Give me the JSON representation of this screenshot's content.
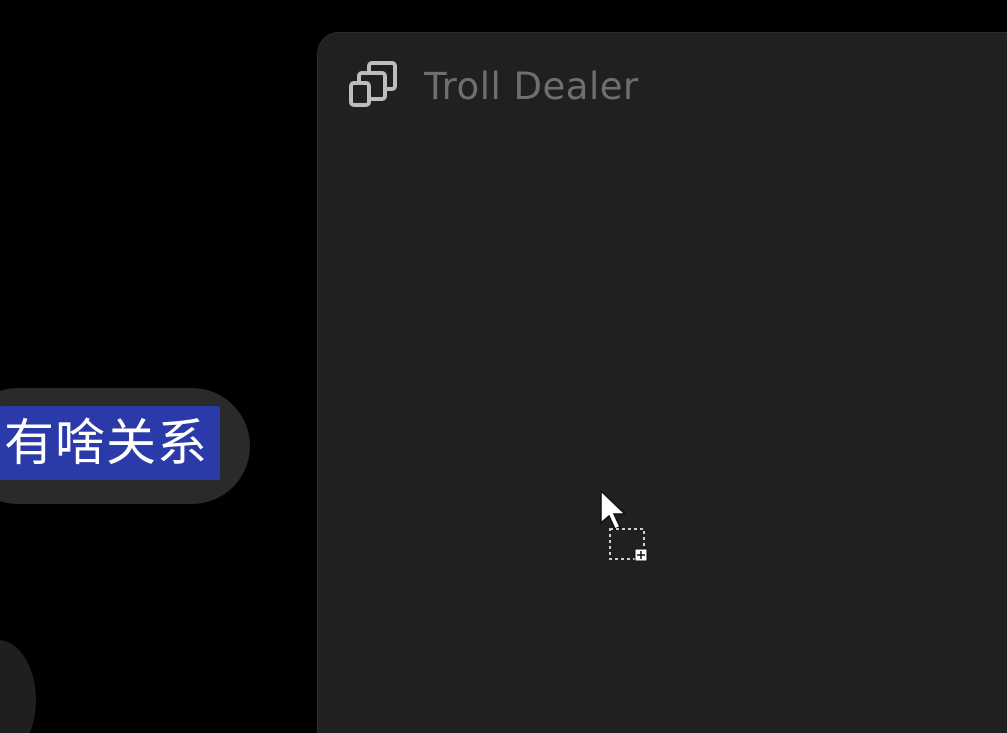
{
  "chat": {
    "highlighted_text": "有啥关系"
  },
  "window": {
    "title": "Troll Dealer",
    "icon": "window-stack-icon"
  },
  "cursor": {
    "icon": "pointer-copy-cursor-icon"
  },
  "colors": {
    "background": "#000000",
    "window_bg": "#202020",
    "bubble_bg": "#2a2a2a",
    "highlight": "#2a3aa8",
    "title_text": "#6f6f6f"
  }
}
